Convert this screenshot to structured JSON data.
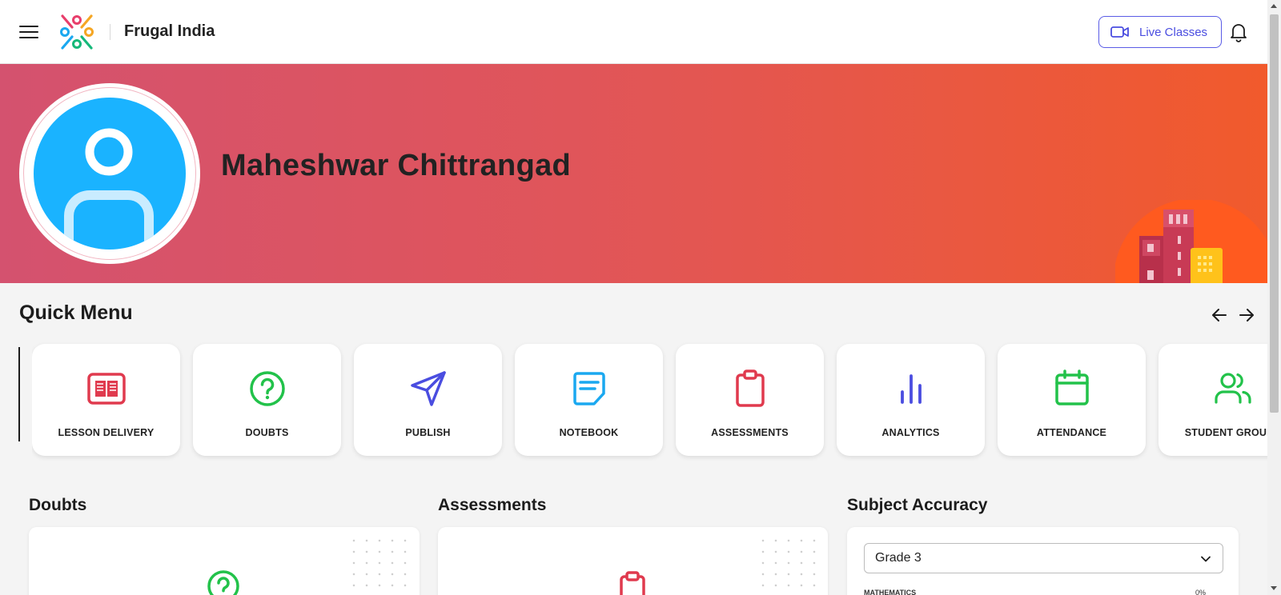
{
  "header": {
    "brand": "Frugal India",
    "live_classes_label": "Live Classes",
    "icons": [
      "hamburger-menu-icon",
      "brand-logo",
      "video-camera-icon",
      "bell-icon"
    ],
    "accent_color": "#4a4de0"
  },
  "banner": {
    "user_name": "Maheshwar Chittrangad",
    "gradient": [
      "#d4526f",
      "#f15a2c"
    ],
    "avatar_color": "#1ab3ff"
  },
  "quick_menu": {
    "title": "Quick Menu",
    "items": [
      {
        "label": "LESSON DELIVERY",
        "icon": "book-icon",
        "color": "#e03a4e"
      },
      {
        "label": "DOUBTS",
        "icon": "question-circle-icon",
        "color": "#22c24a"
      },
      {
        "label": "PUBLISH",
        "icon": "send-icon",
        "color": "#4a4de0"
      },
      {
        "label": "NOTEBOOK",
        "icon": "notebook-icon",
        "color": "#1aa8f0"
      },
      {
        "label": "ASSESSMENTS",
        "icon": "clipboard-icon",
        "color": "#e03a4e"
      },
      {
        "label": "ANALYTICS",
        "icon": "bar-chart-icon",
        "color": "#4a4de0"
      },
      {
        "label": "ATTENDANCE",
        "icon": "calendar-icon",
        "color": "#22c24a"
      },
      {
        "label": "STUDENT GROUPS",
        "icon": "users-icon",
        "color": "#22c24a"
      }
    ]
  },
  "sections": {
    "doubts_title": "Doubts",
    "assessments_title": "Assessments",
    "subject_accuracy_title": "Subject Accuracy"
  },
  "subject_accuracy": {
    "selected_grade": "Grade 3",
    "first_row_subject": "MATHEMATICS",
    "first_row_value": "0%"
  }
}
